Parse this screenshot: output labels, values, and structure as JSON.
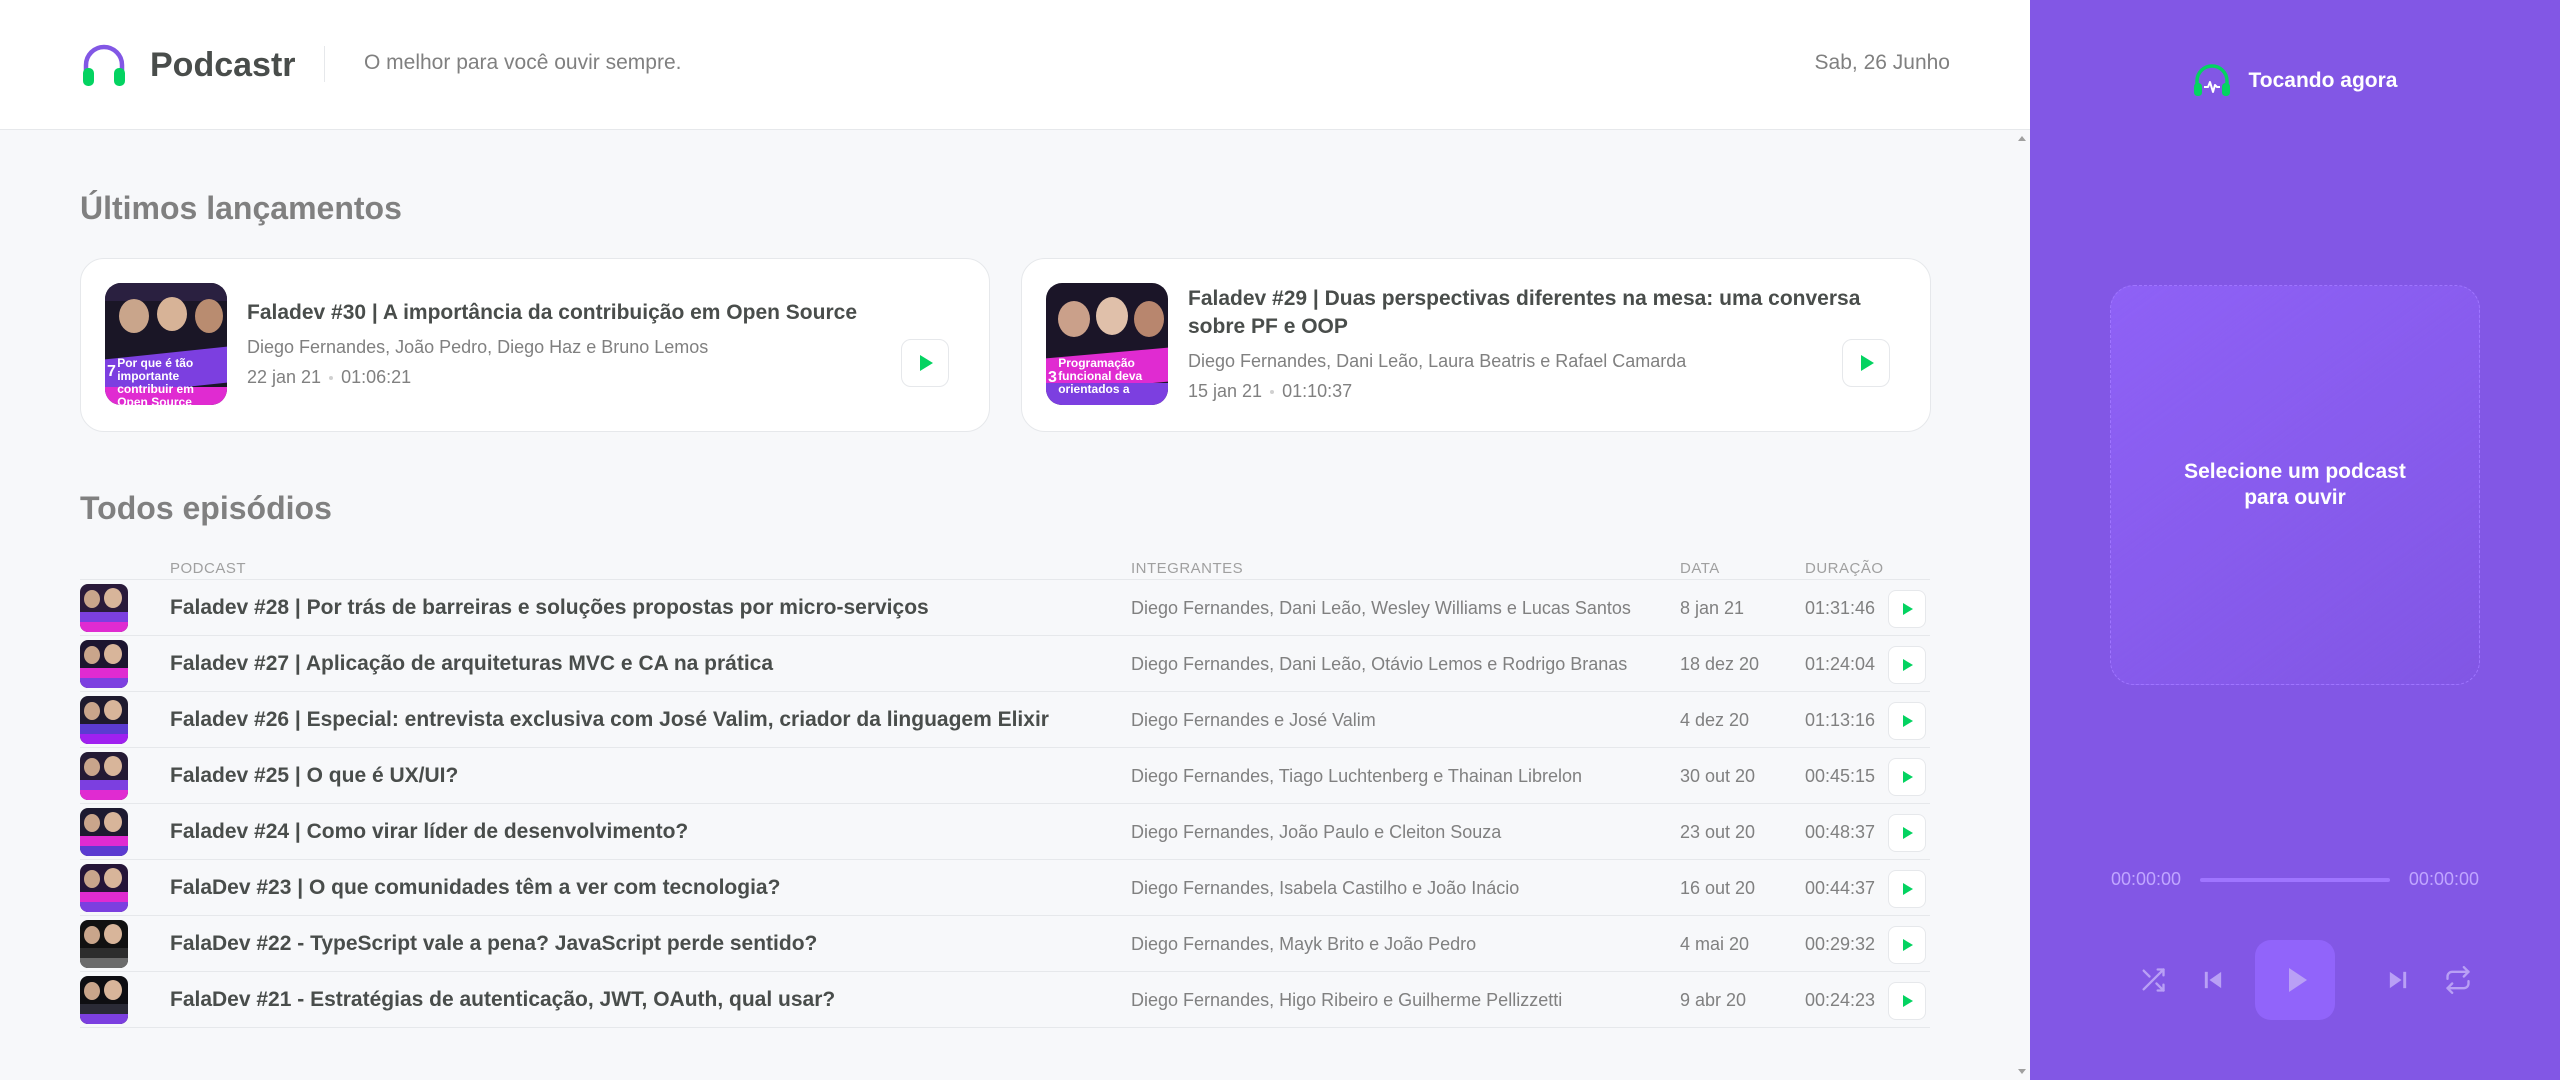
{
  "app": {
    "name": "Podcastr",
    "tagline": "O melhor para você ouvir sempre.",
    "date": "Sab, 26 Junho"
  },
  "colors": {
    "brand_purple": "#8257e5",
    "accent_green": "#04d361",
    "text_dark": "#494d4b",
    "text_muted": "#808080"
  },
  "latest": {
    "title": "Últimos lançamentos",
    "episodes": [
      {
        "title": "Faladev #30 | A importância da contribuição em Open Source",
        "members": "Diego Fernandes, João Pedro, Diego Haz e Bruno Lemos",
        "date": "22 jan 21",
        "duration": "01:06:21",
        "thumb_caption": "Por que é tão importante contribuir em Open Source",
        "thumb_number": "7"
      },
      {
        "title": "Faladev #29 | Duas perspectivas diferentes na mesa: uma conversa sobre PF e OOP",
        "members": "Diego Fernandes, Dani Leão, Laura Beatris e Rafael Camarda",
        "date": "15 jan 21",
        "duration": "01:10:37",
        "thumb_caption": "Programação funcional deva orientados a",
        "thumb_number": "3"
      }
    ]
  },
  "all": {
    "title": "Todos episódios",
    "columns": {
      "podcast": "PODCAST",
      "members": "INTEGRANTES",
      "date": "DATA",
      "duration": "DURAÇÃO"
    },
    "episodes": [
      {
        "title": "Faladev #28 | Por trás de barreiras e soluções propostas por micro-serviços",
        "members": "Diego Fernandes, Dani Leão, Wesley Williams e Lucas Santos",
        "date": "8 jan 21",
        "duration": "01:31:46"
      },
      {
        "title": "Faladev #27 | Aplicação de arquiteturas MVC e CA na prática",
        "members": "Diego Fernandes, Dani Leão, Otávio Lemos e Rodrigo Branas",
        "date": "18 dez 20",
        "duration": "01:24:04"
      },
      {
        "title": "Faladev #26 | Especial: entrevista exclusiva com José Valim, criador da linguagem Elixir",
        "members": "Diego Fernandes e José Valim",
        "date": "4 dez 20",
        "duration": "01:13:16"
      },
      {
        "title": "Faladev #25 | O que é UX/UI?",
        "members": "Diego Fernandes, Tiago Luchtenberg e Thainan Librelon",
        "date": "30 out 20",
        "duration": "00:45:15"
      },
      {
        "title": "Faladev #24 | Como virar líder de desenvolvimento?",
        "members": "Diego Fernandes, João Paulo e Cleiton Souza",
        "date": "23 out 20",
        "duration": "00:48:37"
      },
      {
        "title": "FalaDev #23 | O que comunidades têm a ver com tecnologia?",
        "members": "Diego Fernandes, Isabela Castilho e João Inácio",
        "date": "16 out 20",
        "duration": "00:44:37"
      },
      {
        "title": "FalaDev #22 - TypeScript vale a pena? JavaScript perde sentido?",
        "members": "Diego Fernandes, Mayk Brito e João Pedro",
        "date": "4 mai 20",
        "duration": "00:29:32"
      },
      {
        "title": "FalaDev #21 - Estratégias de autenticação, JWT, OAuth, qual usar?",
        "members": "Diego Fernandes, Higo Ribeiro e Guilherme Pellizzetti",
        "date": "9 abr 20",
        "duration": "00:24:23"
      }
    ]
  },
  "player": {
    "heading": "Tocando agora",
    "empty_message": "Selecione um podcast para ouvir",
    "time_current": "00:00:00",
    "time_total": "00:00:00",
    "progress": 0,
    "icons": [
      "shuffle-icon",
      "previous-icon",
      "play-icon",
      "next-icon",
      "repeat-icon"
    ]
  }
}
